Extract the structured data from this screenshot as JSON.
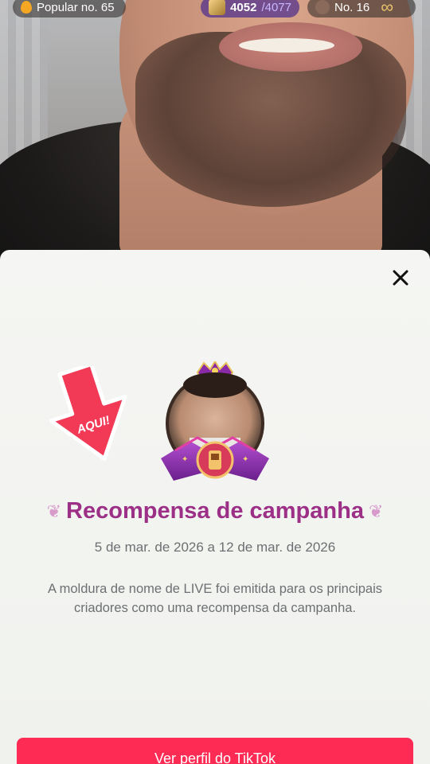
{
  "topbar": {
    "popular_label": "Popular no. 65",
    "score_current": "4052",
    "score_total": "/4077",
    "rank_label": "No. 16"
  },
  "sheet": {
    "arrow_text": "AQUI!",
    "title": "Recompensa de campanha",
    "dates": "5 de mar. de 2026 a 12 de mar. de 2026",
    "description": "A moldura de nome de LIVE foi emitida para os principais criadores como uma recompensa da campanha.",
    "cta_label": "Ver perfil do TikTok"
  },
  "colors": {
    "title": "#9c2f86",
    "cta": "#fe2c55",
    "arrow": "#f23a57"
  },
  "icons": {
    "close": "close-icon",
    "flame": "flame-icon",
    "infinity": "infinity-icon"
  }
}
